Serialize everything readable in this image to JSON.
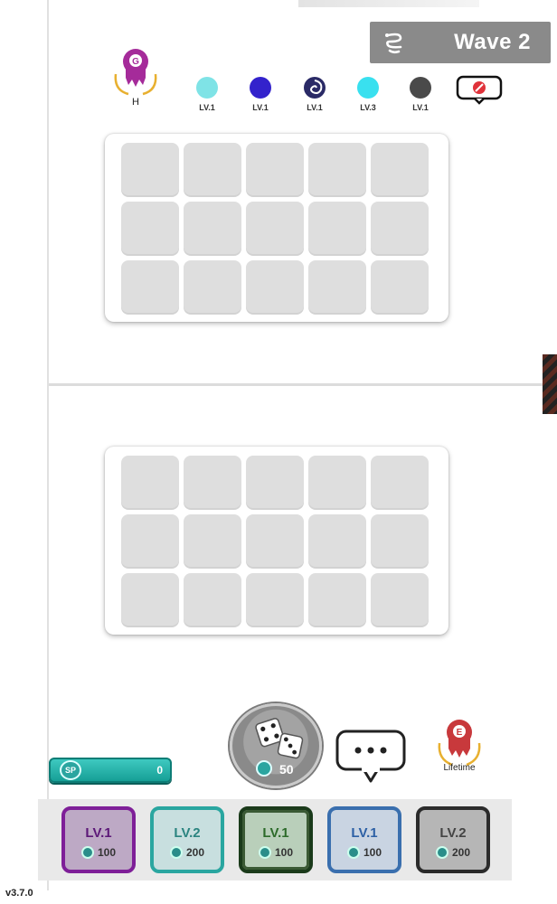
{
  "wave": {
    "label": "Wave 2"
  },
  "opponent": {
    "player_label": "H",
    "dice": [
      {
        "color": "#7fe3e6",
        "level": "LV.1"
      },
      {
        "color": "#3322cc",
        "level": "LV.1"
      },
      {
        "color": "#2a2a66",
        "level": "LV.1",
        "icon": "swirl-die-icon"
      },
      {
        "color": "#39e0ef",
        "level": "LV.3"
      },
      {
        "color": "#4a4a4a",
        "level": "LV.1"
      }
    ]
  },
  "self": {
    "player_label": "Lifetime"
  },
  "sp": {
    "value": "0",
    "icon_label": "SP"
  },
  "roll": {
    "cost": "50"
  },
  "deck": [
    {
      "level": "LV.1",
      "cost": "100",
      "color": "#7e1f98"
    },
    {
      "level": "LV.2",
      "cost": "200",
      "color": "#2aa6a0"
    },
    {
      "level": "LV.1",
      "cost": "100",
      "color": "#2d6b2a"
    },
    {
      "level": "LV.1",
      "cost": "100",
      "color": "#3a6fae"
    },
    {
      "level": "LV.2",
      "cost": "200",
      "color": "#2b2b2b"
    }
  ],
  "version": "v3.7.0"
}
